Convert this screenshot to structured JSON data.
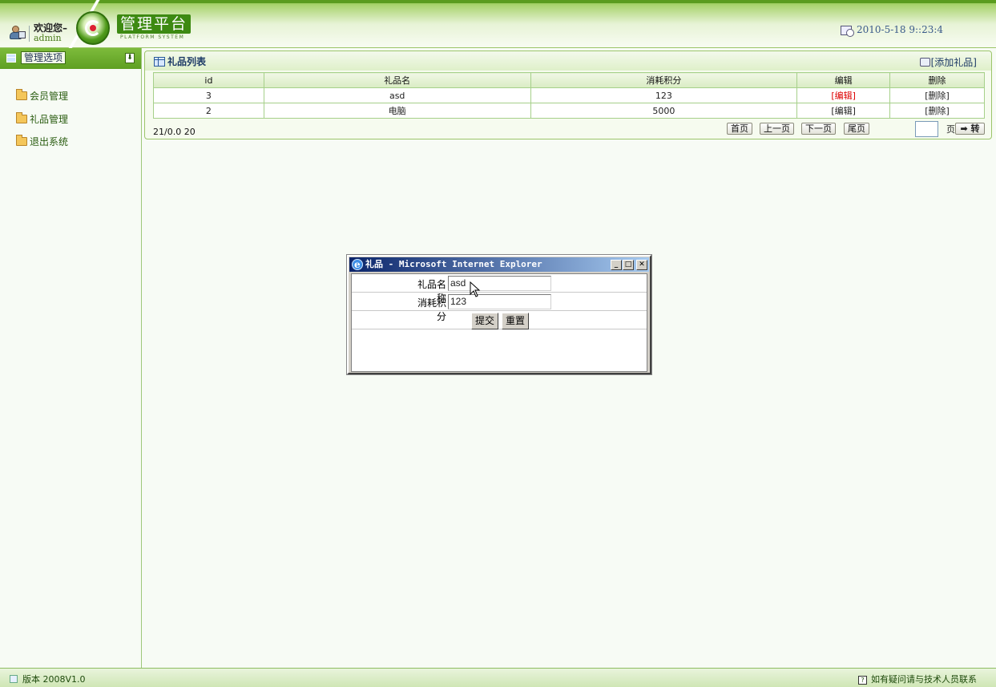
{
  "header": {
    "welcome": "欢迎您–",
    "username": "admin",
    "platform_title": "管理平台",
    "platform_subtitle": "PLATFORM SYSTEM",
    "datetime": "2010-5-18 9::23:4"
  },
  "sidebar": {
    "heading": "管理选项",
    "items": [
      {
        "label": "会员管理"
      },
      {
        "label": "礼品管理"
      },
      {
        "label": "退出系统"
      }
    ]
  },
  "panel": {
    "title": "礼品列表",
    "add_link": "[添加礼品]",
    "columns": [
      "id",
      "礼品名",
      "消耗积分",
      "编辑",
      "删除"
    ],
    "rows": [
      {
        "id": "3",
        "name": "asd",
        "points": "123",
        "edit": "[编辑]",
        "delete": "[删除]"
      },
      {
        "id": "2",
        "name": "电脑",
        "points": "5000",
        "edit": "[编辑]",
        "delete": "[删除]"
      }
    ],
    "pager_info": "21/0.0 20",
    "pager": {
      "first": "首页",
      "prev": "上一页",
      "next": "下一页",
      "last": "尾页",
      "page_label": "页",
      "go": "➡ 转",
      "page_value": ""
    }
  },
  "popup": {
    "title": "礼品 - Microsoft Internet Explorer",
    "name_label": "礼品名称",
    "name_value": "asd",
    "points_label": "消耗积分",
    "points_value": "123",
    "submit": "提交",
    "reset": "重置"
  },
  "footer": {
    "version": "版本 2008V1.0",
    "contact": "如有疑问请与技术人员联系"
  },
  "colors": {
    "brand_green": "#3d8a12",
    "title_bar_start": "#0a246a",
    "title_bar_end": "#a6caf0",
    "edit_red": "#dd0000"
  }
}
